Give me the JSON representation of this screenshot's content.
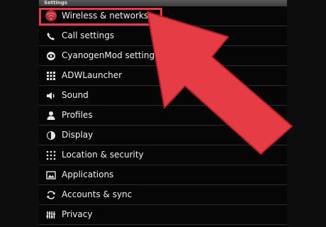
{
  "header": {
    "title": "Settings"
  },
  "settings_items": [
    {
      "label": "Wireless & networks",
      "icon": "wifi-icon"
    },
    {
      "label": "Call settings",
      "icon": "phone-icon"
    },
    {
      "label": "CyanogenMod settings",
      "icon": "eye-icon"
    },
    {
      "label": "ADWLauncher",
      "icon": "grid-icon"
    },
    {
      "label": "Sound",
      "icon": "speaker-icon"
    },
    {
      "label": "Profiles",
      "icon": "person-icon"
    },
    {
      "label": "Display",
      "icon": "brightness-icon"
    },
    {
      "label": "Location & security",
      "icon": "location-grid-icon"
    },
    {
      "label": "Applications",
      "icon": "image-icon"
    },
    {
      "label": "Accounts & sync",
      "icon": "sync-icon"
    },
    {
      "label": "Privacy",
      "icon": "equalizer-icon"
    }
  ],
  "annotation": {
    "highlighted_item": "Wireless & networks",
    "color": "#e33a47"
  }
}
